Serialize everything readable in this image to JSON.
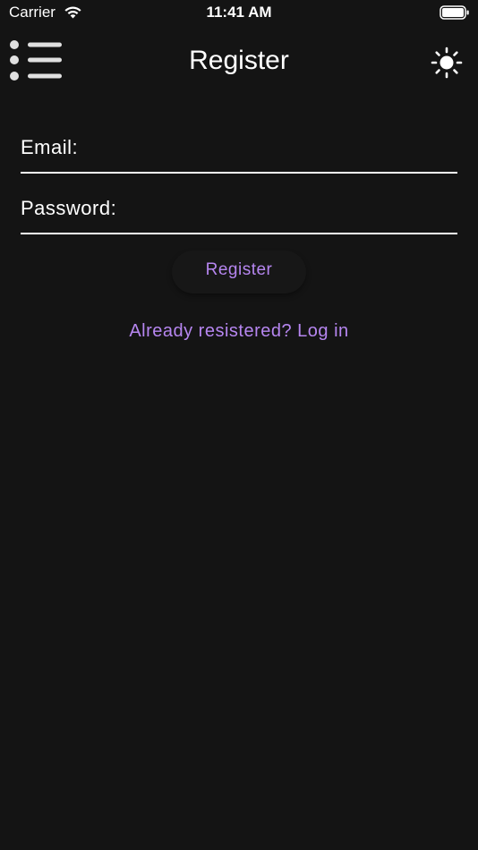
{
  "status_bar": {
    "carrier": "Carrier",
    "time": "11:41 AM",
    "icons": [
      "wifi-icon",
      "battery-icon"
    ]
  },
  "header": {
    "title": "Register",
    "menu_icon": "list-menu-icon",
    "theme_icon": "sun-icon"
  },
  "form": {
    "email_label": "Email:",
    "email_value": "",
    "password_label": "Password:",
    "password_value": "",
    "register_label": "Register",
    "login_link": "Already resistered? Log in"
  },
  "colors": {
    "background": "#141414",
    "text": "#ffffff",
    "accent": "#b686f0"
  }
}
